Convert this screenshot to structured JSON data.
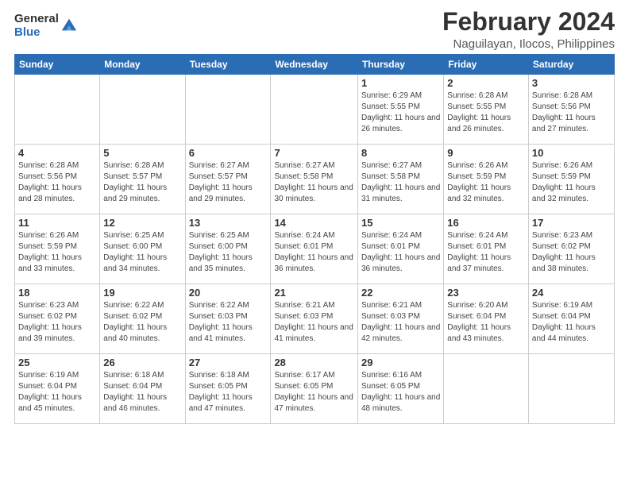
{
  "logo": {
    "general": "General",
    "blue": "Blue"
  },
  "title": "February 2024",
  "subtitle": "Naguilayan, Ilocos, Philippines",
  "days": [
    "Sunday",
    "Monday",
    "Tuesday",
    "Wednesday",
    "Thursday",
    "Friday",
    "Saturday"
  ],
  "weeks": [
    [
      {
        "num": "",
        "info": ""
      },
      {
        "num": "",
        "info": ""
      },
      {
        "num": "",
        "info": ""
      },
      {
        "num": "",
        "info": ""
      },
      {
        "num": "1",
        "info": "Sunrise: 6:29 AM\nSunset: 5:55 PM\nDaylight: 11 hours and 26 minutes."
      },
      {
        "num": "2",
        "info": "Sunrise: 6:28 AM\nSunset: 5:55 PM\nDaylight: 11 hours and 26 minutes."
      },
      {
        "num": "3",
        "info": "Sunrise: 6:28 AM\nSunset: 5:56 PM\nDaylight: 11 hours and 27 minutes."
      }
    ],
    [
      {
        "num": "4",
        "info": "Sunrise: 6:28 AM\nSunset: 5:56 PM\nDaylight: 11 hours and 28 minutes."
      },
      {
        "num": "5",
        "info": "Sunrise: 6:28 AM\nSunset: 5:57 PM\nDaylight: 11 hours and 29 minutes."
      },
      {
        "num": "6",
        "info": "Sunrise: 6:27 AM\nSunset: 5:57 PM\nDaylight: 11 hours and 29 minutes."
      },
      {
        "num": "7",
        "info": "Sunrise: 6:27 AM\nSunset: 5:58 PM\nDaylight: 11 hours and 30 minutes."
      },
      {
        "num": "8",
        "info": "Sunrise: 6:27 AM\nSunset: 5:58 PM\nDaylight: 11 hours and 31 minutes."
      },
      {
        "num": "9",
        "info": "Sunrise: 6:26 AM\nSunset: 5:59 PM\nDaylight: 11 hours and 32 minutes."
      },
      {
        "num": "10",
        "info": "Sunrise: 6:26 AM\nSunset: 5:59 PM\nDaylight: 11 hours and 32 minutes."
      }
    ],
    [
      {
        "num": "11",
        "info": "Sunrise: 6:26 AM\nSunset: 5:59 PM\nDaylight: 11 hours and 33 minutes."
      },
      {
        "num": "12",
        "info": "Sunrise: 6:25 AM\nSunset: 6:00 PM\nDaylight: 11 hours and 34 minutes."
      },
      {
        "num": "13",
        "info": "Sunrise: 6:25 AM\nSunset: 6:00 PM\nDaylight: 11 hours and 35 minutes."
      },
      {
        "num": "14",
        "info": "Sunrise: 6:24 AM\nSunset: 6:01 PM\nDaylight: 11 hours and 36 minutes."
      },
      {
        "num": "15",
        "info": "Sunrise: 6:24 AM\nSunset: 6:01 PM\nDaylight: 11 hours and 36 minutes."
      },
      {
        "num": "16",
        "info": "Sunrise: 6:24 AM\nSunset: 6:01 PM\nDaylight: 11 hours and 37 minutes."
      },
      {
        "num": "17",
        "info": "Sunrise: 6:23 AM\nSunset: 6:02 PM\nDaylight: 11 hours and 38 minutes."
      }
    ],
    [
      {
        "num": "18",
        "info": "Sunrise: 6:23 AM\nSunset: 6:02 PM\nDaylight: 11 hours and 39 minutes."
      },
      {
        "num": "19",
        "info": "Sunrise: 6:22 AM\nSunset: 6:02 PM\nDaylight: 11 hours and 40 minutes."
      },
      {
        "num": "20",
        "info": "Sunrise: 6:22 AM\nSunset: 6:03 PM\nDaylight: 11 hours and 41 minutes."
      },
      {
        "num": "21",
        "info": "Sunrise: 6:21 AM\nSunset: 6:03 PM\nDaylight: 11 hours and 41 minutes."
      },
      {
        "num": "22",
        "info": "Sunrise: 6:21 AM\nSunset: 6:03 PM\nDaylight: 11 hours and 42 minutes."
      },
      {
        "num": "23",
        "info": "Sunrise: 6:20 AM\nSunset: 6:04 PM\nDaylight: 11 hours and 43 minutes."
      },
      {
        "num": "24",
        "info": "Sunrise: 6:19 AM\nSunset: 6:04 PM\nDaylight: 11 hours and 44 minutes."
      }
    ],
    [
      {
        "num": "25",
        "info": "Sunrise: 6:19 AM\nSunset: 6:04 PM\nDaylight: 11 hours and 45 minutes."
      },
      {
        "num": "26",
        "info": "Sunrise: 6:18 AM\nSunset: 6:04 PM\nDaylight: 11 hours and 46 minutes."
      },
      {
        "num": "27",
        "info": "Sunrise: 6:18 AM\nSunset: 6:05 PM\nDaylight: 11 hours and 47 minutes."
      },
      {
        "num": "28",
        "info": "Sunrise: 6:17 AM\nSunset: 6:05 PM\nDaylight: 11 hours and 47 minutes."
      },
      {
        "num": "29",
        "info": "Sunrise: 6:16 AM\nSunset: 6:05 PM\nDaylight: 11 hours and 48 minutes."
      },
      {
        "num": "",
        "info": ""
      },
      {
        "num": "",
        "info": ""
      }
    ]
  ]
}
